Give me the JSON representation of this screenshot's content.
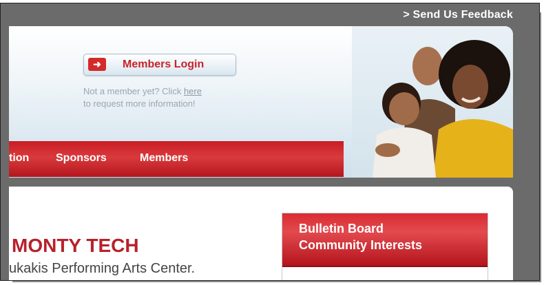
{
  "header": {
    "feedback_link": "> Send Us Feedback"
  },
  "login": {
    "button_label": "Members Login",
    "arrow_glyph": "➜",
    "notice_prefix": "Not a member yet? Click ",
    "notice_link": "here",
    "notice_suffix": "to request more information!"
  },
  "nav": {
    "items": [
      {
        "label": "tion"
      },
      {
        "label": "Sponsors"
      },
      {
        "label": "Members"
      }
    ]
  },
  "main": {
    "heading": "MONTY TECH",
    "subtext": "ukakis Performing Arts Center."
  },
  "bulletin": {
    "line1": "Bulletin Board",
    "line2": "Community Interests"
  },
  "colors": {
    "accent_red": "#c8222a",
    "page_gray": "#6b6b6b"
  }
}
